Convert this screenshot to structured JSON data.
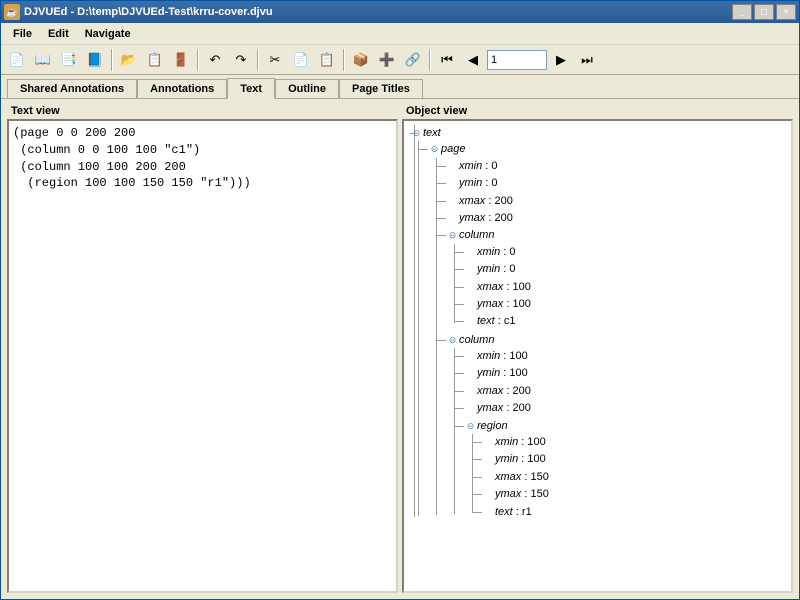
{
  "title": "DJVUEd - D:\\temp\\DJVUEd-Test\\krru-cover.djvu",
  "menubar": [
    "File",
    "Edit",
    "Navigate"
  ],
  "toolbar_icons": [
    "📄",
    "📖",
    "📑",
    "📘",
    "📂",
    "📋",
    "🚪",
    "↶",
    "↷",
    "✂",
    "📄",
    "📋",
    "📦",
    "➕",
    "🔗",
    "⏮",
    "◀",
    "▶",
    "⏭"
  ],
  "page_input": "1",
  "tabs": [
    "Shared Annotations",
    "Annotations",
    "Text",
    "Outline",
    "Page Titles"
  ],
  "active_tab": 2,
  "panes": {
    "left": "Text view",
    "right": "Object view"
  },
  "text_view": "(page 0 0 200 200\n (column 0 0 100 100 \"c1\")\n (column 100 100 200 200\n  (region 100 100 150 150 \"r1\")))",
  "object_tree": {
    "label": "text",
    "children": [
      {
        "label": "page",
        "children": [
          {
            "key": "xmin",
            "val": "0"
          },
          {
            "key": "ymin",
            "val": "0"
          },
          {
            "key": "xmax",
            "val": "200"
          },
          {
            "key": "ymax",
            "val": "200"
          },
          {
            "label": "column",
            "children": [
              {
                "key": "xmin",
                "val": "0"
              },
              {
                "key": "ymin",
                "val": "0"
              },
              {
                "key": "xmax",
                "val": "100"
              },
              {
                "key": "ymax",
                "val": "100"
              },
              {
                "key": "text",
                "val": "c1"
              }
            ]
          },
          {
            "label": "column",
            "children": [
              {
                "key": "xmin",
                "val": "100"
              },
              {
                "key": "ymin",
                "val": "100"
              },
              {
                "key": "xmax",
                "val": "200"
              },
              {
                "key": "ymax",
                "val": "200"
              },
              {
                "label": "region",
                "children": [
                  {
                    "key": "xmin",
                    "val": "100"
                  },
                  {
                    "key": "ymin",
                    "val": "100"
                  },
                  {
                    "key": "xmax",
                    "val": "150"
                  },
                  {
                    "key": "ymax",
                    "val": "150"
                  },
                  {
                    "key": "text",
                    "val": "r1"
                  }
                ]
              }
            ]
          }
        ]
      }
    ]
  }
}
